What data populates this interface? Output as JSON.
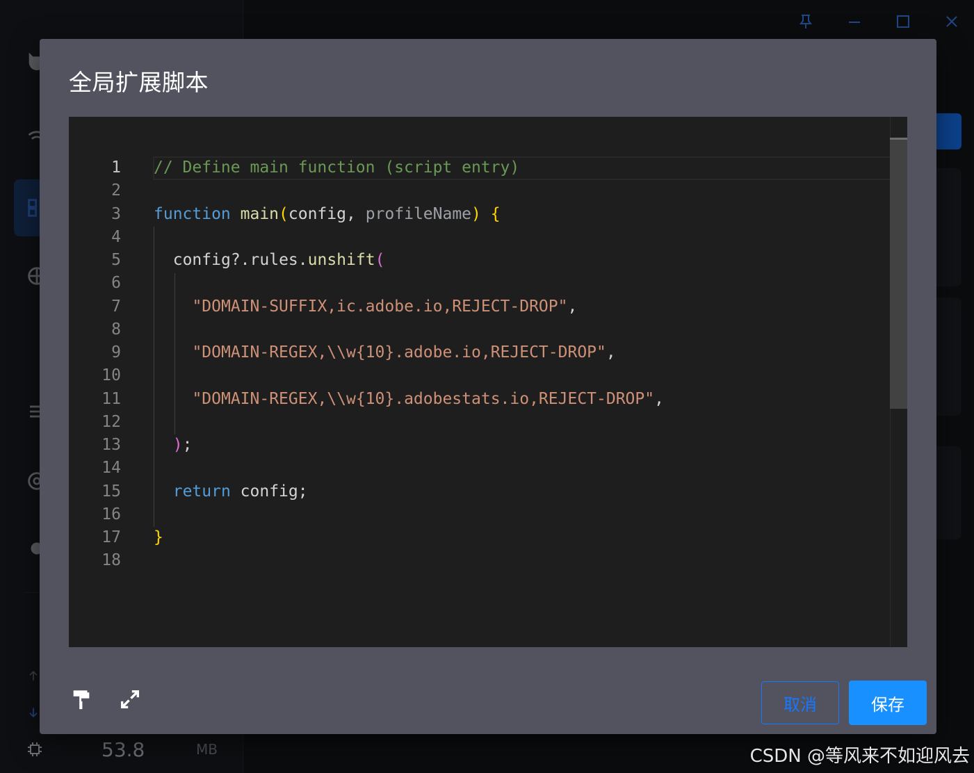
{
  "app": {
    "memory": {
      "value": "53.8",
      "unit": "MB"
    },
    "titlebar": {
      "icons": [
        "pin-icon",
        "minimize-icon",
        "maximize-icon",
        "close-icon"
      ]
    }
  },
  "dialog": {
    "title": "全局扩展脚本",
    "cancel_label": "取消",
    "save_label": "保存",
    "tools": [
      "format-paint-icon",
      "expand-icon"
    ]
  },
  "editor": {
    "language": "javascript",
    "active_line": 1,
    "lines": [
      {
        "n": "1",
        "text": "// Define main function (script entry)"
      },
      {
        "n": "2",
        "text": ""
      },
      {
        "n": "3",
        "text": "function main(config, profileName) {"
      },
      {
        "n": "4",
        "text": ""
      },
      {
        "n": "5",
        "text": "  config?.rules.unshift("
      },
      {
        "n": "6",
        "text": ""
      },
      {
        "n": "7",
        "text": "    \"DOMAIN-SUFFIX,ic.adobe.io,REJECT-DROP\","
      },
      {
        "n": "8",
        "text": ""
      },
      {
        "n": "9",
        "text": "    \"DOMAIN-REGEX,\\\\w{10}.adobe.io,REJECT-DROP\","
      },
      {
        "n": "10",
        "text": ""
      },
      {
        "n": "11",
        "text": "    \"DOMAIN-REGEX,\\\\w{10}.adobestats.io,REJECT-DROP\","
      },
      {
        "n": "12",
        "text": ""
      },
      {
        "n": "13",
        "text": "  );"
      },
      {
        "n": "14",
        "text": ""
      },
      {
        "n": "15",
        "text": "  return config;"
      },
      {
        "n": "16",
        "text": ""
      },
      {
        "n": "17",
        "text": "}"
      },
      {
        "n": "18",
        "text": ""
      }
    ]
  },
  "watermark": "CSDN @等风来不如迎风去",
  "colors": {
    "accent": "#1677ff",
    "dialog_bg": "#52535f",
    "editor_bg": "#1e1e1e",
    "comment": "#6a9955",
    "keyword": "#569cd6",
    "function": "#dcdcaa",
    "string": "#ce9178"
  }
}
